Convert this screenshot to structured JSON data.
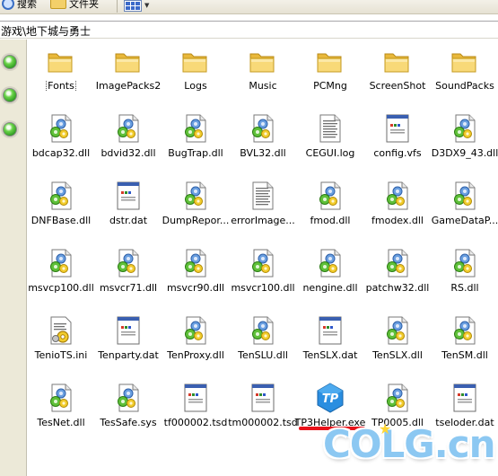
{
  "toolbar": {
    "search_label": "搜索",
    "folders_label": "文件夹"
  },
  "address": {
    "path": "游戏\\地下城与勇士"
  },
  "files": [
    {
      "name": "Fonts",
      "type": "folder"
    },
    {
      "name": "ImagePacks2",
      "type": "folder"
    },
    {
      "name": "Logs",
      "type": "folder"
    },
    {
      "name": "Music",
      "type": "folder"
    },
    {
      "name": "PCMng",
      "type": "folder"
    },
    {
      "name": "ScreenShot",
      "type": "folder"
    },
    {
      "name": "SoundPacks",
      "type": "folder"
    },
    {
      "name": "bdcap32.dll",
      "type": "dll"
    },
    {
      "name": "bdvid32.dll",
      "type": "dll"
    },
    {
      "name": "BugTrap.dll",
      "type": "dll"
    },
    {
      "name": "BVL32.dll",
      "type": "dll"
    },
    {
      "name": "CEGUI.log",
      "type": "log"
    },
    {
      "name": "config.vfs",
      "type": "dat"
    },
    {
      "name": "D3DX9_43.dll",
      "type": "dll"
    },
    {
      "name": "DNFBase.dll",
      "type": "dll"
    },
    {
      "name": "dstr.dat",
      "type": "dat"
    },
    {
      "name": "DumpRepor...",
      "type": "dll"
    },
    {
      "name": "errorImage...",
      "type": "log"
    },
    {
      "name": "fmod.dll",
      "type": "dll"
    },
    {
      "name": "fmodex.dll",
      "type": "dll"
    },
    {
      "name": "GameDataP...",
      "type": "dll"
    },
    {
      "name": "msvcp100.dll",
      "type": "dll"
    },
    {
      "name": "msvcr71.dll",
      "type": "dll"
    },
    {
      "name": "msvcr90.dll",
      "type": "dll"
    },
    {
      "name": "msvcr100.dll",
      "type": "dll"
    },
    {
      "name": "nengine.dll",
      "type": "dll"
    },
    {
      "name": "patchw32.dll",
      "type": "dll"
    },
    {
      "name": "RS.dll",
      "type": "dll"
    },
    {
      "name": "TenioTS.ini",
      "type": "ini"
    },
    {
      "name": "Tenparty.dat",
      "type": "dat"
    },
    {
      "name": "TenProxy.dll",
      "type": "dll"
    },
    {
      "name": "TenSLU.dll",
      "type": "dll"
    },
    {
      "name": "TenSLX.dat",
      "type": "dat"
    },
    {
      "name": "TenSLX.dll",
      "type": "dll"
    },
    {
      "name": "TenSM.dll",
      "type": "dll"
    },
    {
      "name": "TesNet.dll",
      "type": "dll"
    },
    {
      "name": "TesSafe.sys",
      "type": "sys"
    },
    {
      "name": "tf000002.tsd",
      "type": "dat"
    },
    {
      "name": "tm000002.tsd",
      "type": "dat"
    },
    {
      "name": "TP3Helper.exe",
      "type": "exe"
    },
    {
      "name": "TP0005.dll",
      "type": "dll"
    },
    {
      "name": "tseloder.dat",
      "type": "dat"
    }
  ],
  "exe_icon_text": "TP",
  "watermark": "COLG.cn",
  "colors": {
    "annotation": "#e8121a",
    "watermark": "#8cc8f2"
  }
}
